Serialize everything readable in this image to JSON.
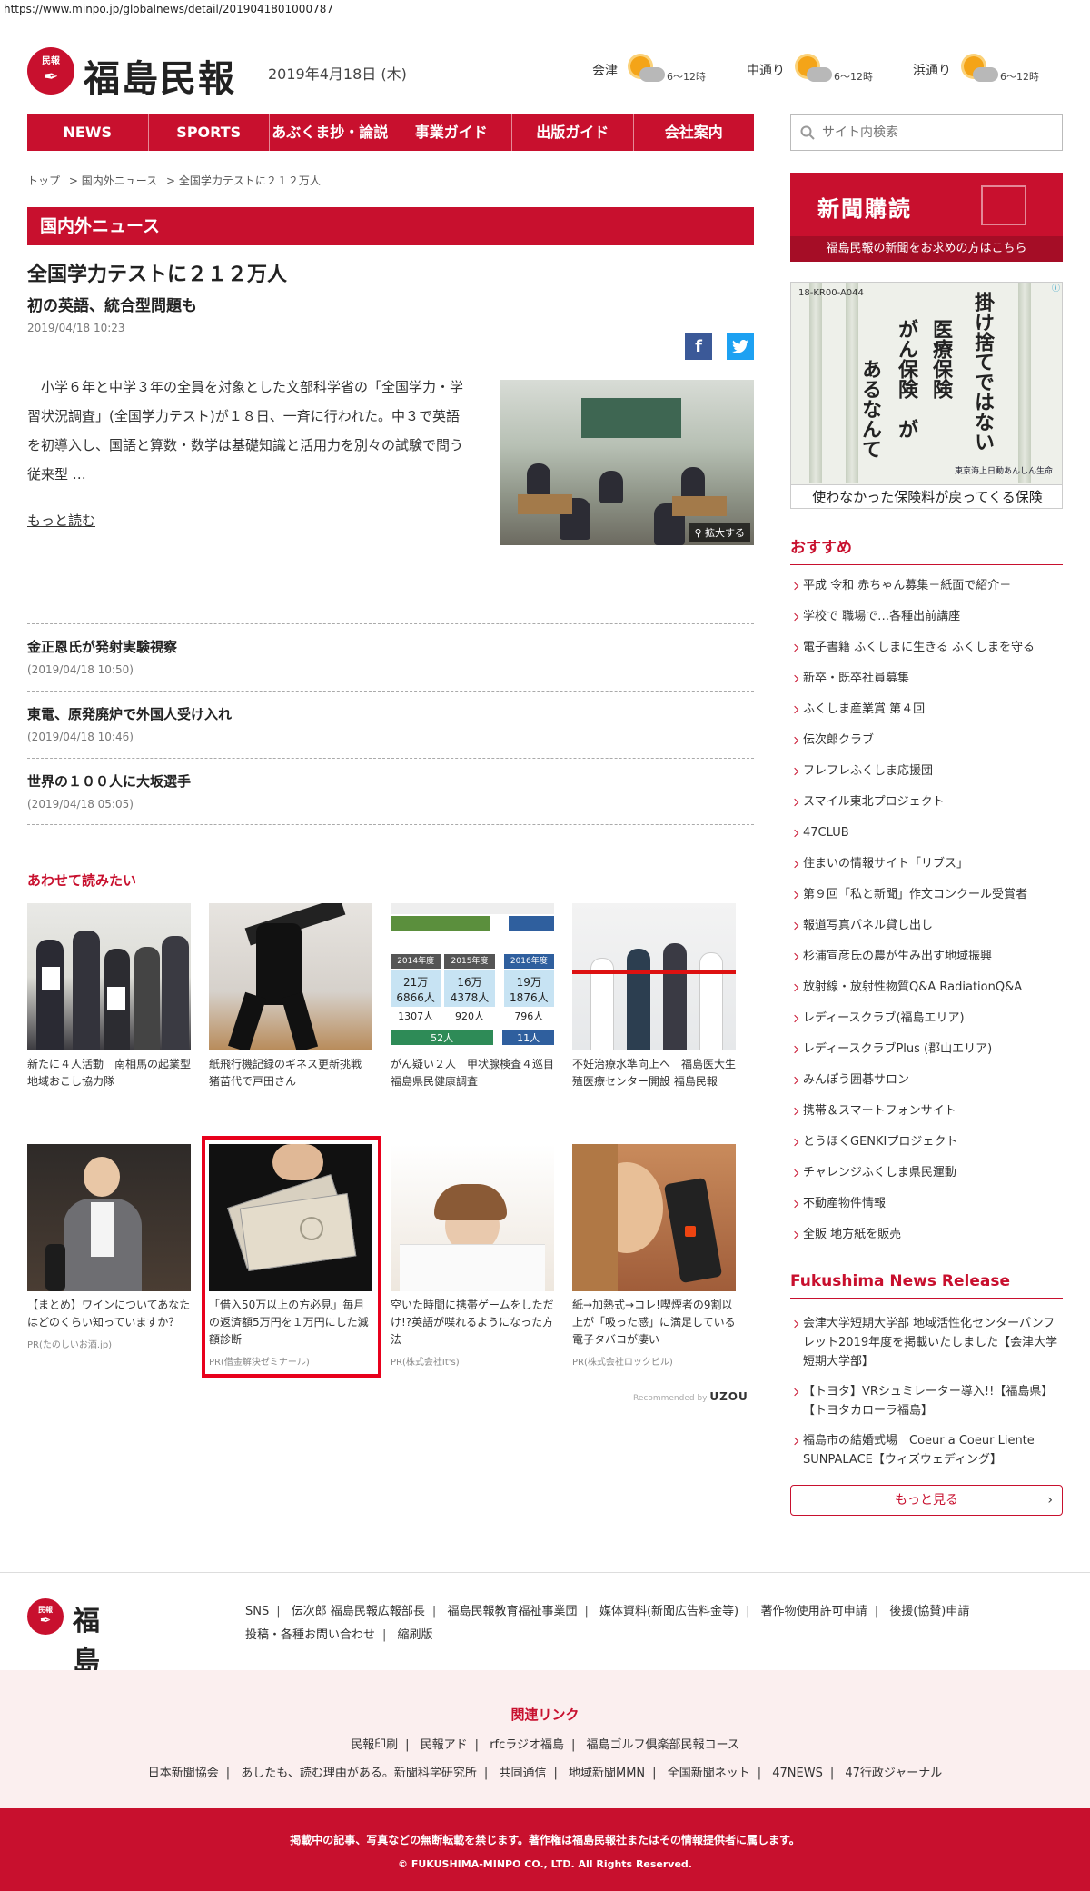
{
  "browser": {
    "url": "https://www.minpo.jp/globalnews/detail/2019041801000787"
  },
  "header": {
    "logo_badge": "民報",
    "logo_text": "福島民報",
    "date": "2019年4月18日 (木)",
    "weather": [
      {
        "place": "会津",
        "temp": "6～12時"
      },
      {
        "place": "中通り",
        "temp": "6～12時"
      },
      {
        "place": "浜通り",
        "temp": "6～12時"
      }
    ]
  },
  "nav": {
    "items": [
      "NEWS",
      "SPORTS",
      "あぶくま抄・論説",
      "事業ガイド",
      "出版ガイド",
      "会社案内"
    ]
  },
  "search": {
    "placeholder": "サイト内検索"
  },
  "breadcrumb": [
    "トップ",
    "> 国内外ニュース",
    "> 全国学力テストに２１２万人"
  ],
  "section": {
    "title": "国内外ニュース"
  },
  "article": {
    "headline": "全国学力テストに２１２万人",
    "subhead": "初の英語、統合型問題も",
    "date": "2019/04/18 10:23",
    "body": "小学６年と中学３年の全員を対象とした文部科学省の「全国学力・学習状況調査」(全国学力テスト)が１８日、一斉に行われた。中３で英語を初導入し、国語と算数・数学は基礎知識と活用力を別々の試験で問う従来型 …",
    "read_more": "もっと読む",
    "zoom_label": "拡大する"
  },
  "news_list": [
    {
      "title": "金正恩氏が発射実験視察",
      "time": "(2019/04/18 10:50)"
    },
    {
      "title": "東電、原発廃炉で外国人受け入れ",
      "time": "(2019/04/18 10:46)"
    },
    {
      "title": "世界の１００人に大坂選手",
      "time": "(2019/04/18 05:05)"
    }
  ],
  "related": {
    "title": "あわせて読みたい",
    "items": [
      {
        "caption": "新たに４人活動　南相馬の起業型地域おこし協力隊",
        "pr": ""
      },
      {
        "caption": "紙飛行機記録のギネス更新挑戦　猪苗代で戸田さん",
        "pr": ""
      },
      {
        "caption": "がん疑い２人　甲状腺検査４巡目　福島県民健康調査",
        "pr": ""
      },
      {
        "caption": "不妊治療水準向上へ　福島医大生殖医療センター開設 福島民報",
        "pr": ""
      },
      {
        "caption": "【まとめ】ワインについてあなたはどのくらい知っていますか？",
        "pr": "PR(たのしいお酒.jp)"
      },
      {
        "caption": "「借入50万以上の方必見」毎月の返済額5万円を１万円にした減額診断",
        "pr": "PR(借金解決ゼミナール)"
      },
      {
        "caption": "空いた時間に携帯ゲームをしただけ!?英語が喋れるようになった方法",
        "pr": "PR(株式会社It's)"
      },
      {
        "caption": "紙→加熱式→コレ!喫煙者の9割以上が「吸った感」に満足している電子タバコが凄い",
        "pr": "PR(株式会社ロックビル)"
      }
    ],
    "table_data": {
      "headers": [
        "2014年度",
        "2015年度",
        "2016年度"
      ],
      "row1": [
        "21万6866人",
        "16万4378人",
        "19万1876人"
      ],
      "row2": [
        "1307人",
        "920人",
        "796人"
      ],
      "row3": [
        "52人",
        "",
        "11人"
      ]
    },
    "recommended_prefix": "Recommended by",
    "recommended_brand": "UZOU"
  },
  "sidebar": {
    "subscribe_title": "新聞購読",
    "subscribe_sub": "福島民報の新聞をお求めの方はこちら",
    "ad": {
      "code": "18-KR00-A044",
      "lines": [
        "掛け捨てではない",
        "医療保険",
        "がん保険",
        "が",
        "あるなんて"
      ],
      "brand": "東京海上日動あんしん生命",
      "footer": "使わなかった保険料が戻ってくる保険"
    },
    "recommend_title": "おすすめ",
    "recommend_items": [
      "平成 令和 赤ちゃん募集－紙面で紹介－",
      "学校で 職場で…各種出前講座",
      "電子書籍 ふくしまに生きる ふくしまを守る",
      "新卒・既卒社員募集",
      "ふくしま産業賞 第４回",
      "伝次郎クラブ",
      "フレフレふくしま応援団",
      "スマイル東北プロジェクト",
      "47CLUB",
      "住まいの情報サイト「リブス」",
      "第９回「私と新聞」作文コンクール受賞者",
      "報道写真パネル貸し出し",
      "杉浦宣彦氏の農が生み出す地域振興",
      "放射線・放射性物質Q&A RadiationQ&A",
      "レディースクラブ(福島エリア)",
      "レディースクラブPlus (郡山エリア)",
      "みんぽう囲碁サロン",
      "携帯＆スマートフォンサイト",
      "とうほくGENKIプロジェクト",
      "チャレンジふくしま県民運動",
      "不動産物件情報",
      "全販 地方紙を販売"
    ],
    "release_title": "Fukushima News Release",
    "release_items": [
      "会津大学短期大学部 地域活性化センターパンフレット2019年度を掲載いたしました【会津大学短期大学部】",
      "【トヨタ】VRシュミレーター導入!!【福島県】【トヨタカローラ福島】",
      "福島市の結婚式場　Coeur a Coeur Liente SUNPALACE【ウィズウェディング】"
    ],
    "more_label": "もっと見る"
  },
  "footer": {
    "links_row1": [
      "SNS",
      "伝次郎 福島民報広報部長",
      "福島民報教育福祉事業団",
      "媒体資料(新聞広告料金等)",
      "著作物使用許可申請",
      "後援(協賛)申請"
    ],
    "links_row2": [
      "投稿・各種お問い合わせ",
      "縮刷版"
    ],
    "related_title": "関連リンク",
    "related_row1": [
      "民報印刷",
      "民報アド",
      "rfcラジオ福島",
      "福島ゴルフ倶楽部民報コース"
    ],
    "related_row2": [
      "日本新聞協会",
      "あしたも、読む理由がある。新聞科学研究所",
      "共同通信",
      "地域新聞MMN",
      "全国新聞ネット",
      "47NEWS",
      "47行政ジャーナル"
    ],
    "notice": "掲載中の記事、写真などの無断転載を禁じます。著作権は福島民報社またはその情報提供者に属します。",
    "copyright": "© FUKUSHIMA-MINPO CO., LTD. All Rights Reserved."
  }
}
